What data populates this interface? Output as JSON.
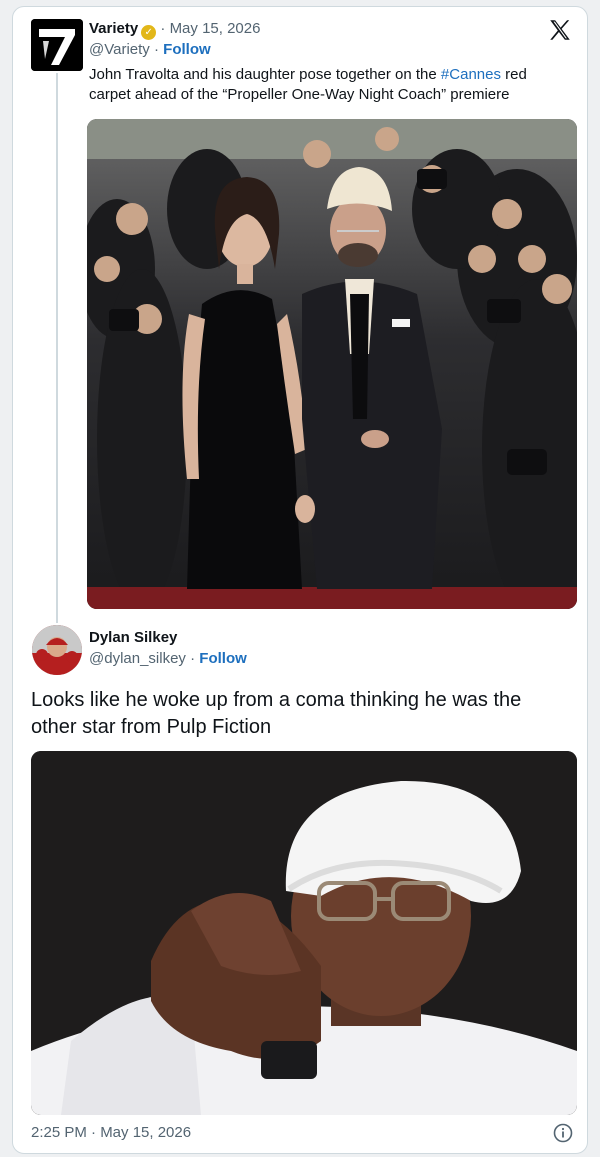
{
  "quoted_tweet": {
    "author_name": "Variety",
    "author_handle": "@Variety",
    "separator": "·",
    "date": "May 15, 2026",
    "follow_label": "Follow",
    "text_before": "John Travolta and his daughter pose together on the ",
    "hashtag": "#Cannes",
    "text_after": " red carpet ahead of the “Propeller One-Way Night Coach” premiere",
    "avatar_icon": "variety-logo-icon",
    "platform_icon": "x-logo-icon"
  },
  "reply": {
    "author_name": "Dylan Silkey",
    "author_handle": "@dylan_silkey",
    "separator": "·",
    "follow_label": "Follow",
    "text": "Looks like he woke up from a coma thinking he was the other star from Pulp Fiction"
  },
  "footer": {
    "timestamp": "2:25 PM · May 15, 2026",
    "info_icon": "info-icon"
  },
  "colors": {
    "link": "#1d6fbe",
    "muted": "#536471",
    "verified_badge": "#e2b719"
  }
}
